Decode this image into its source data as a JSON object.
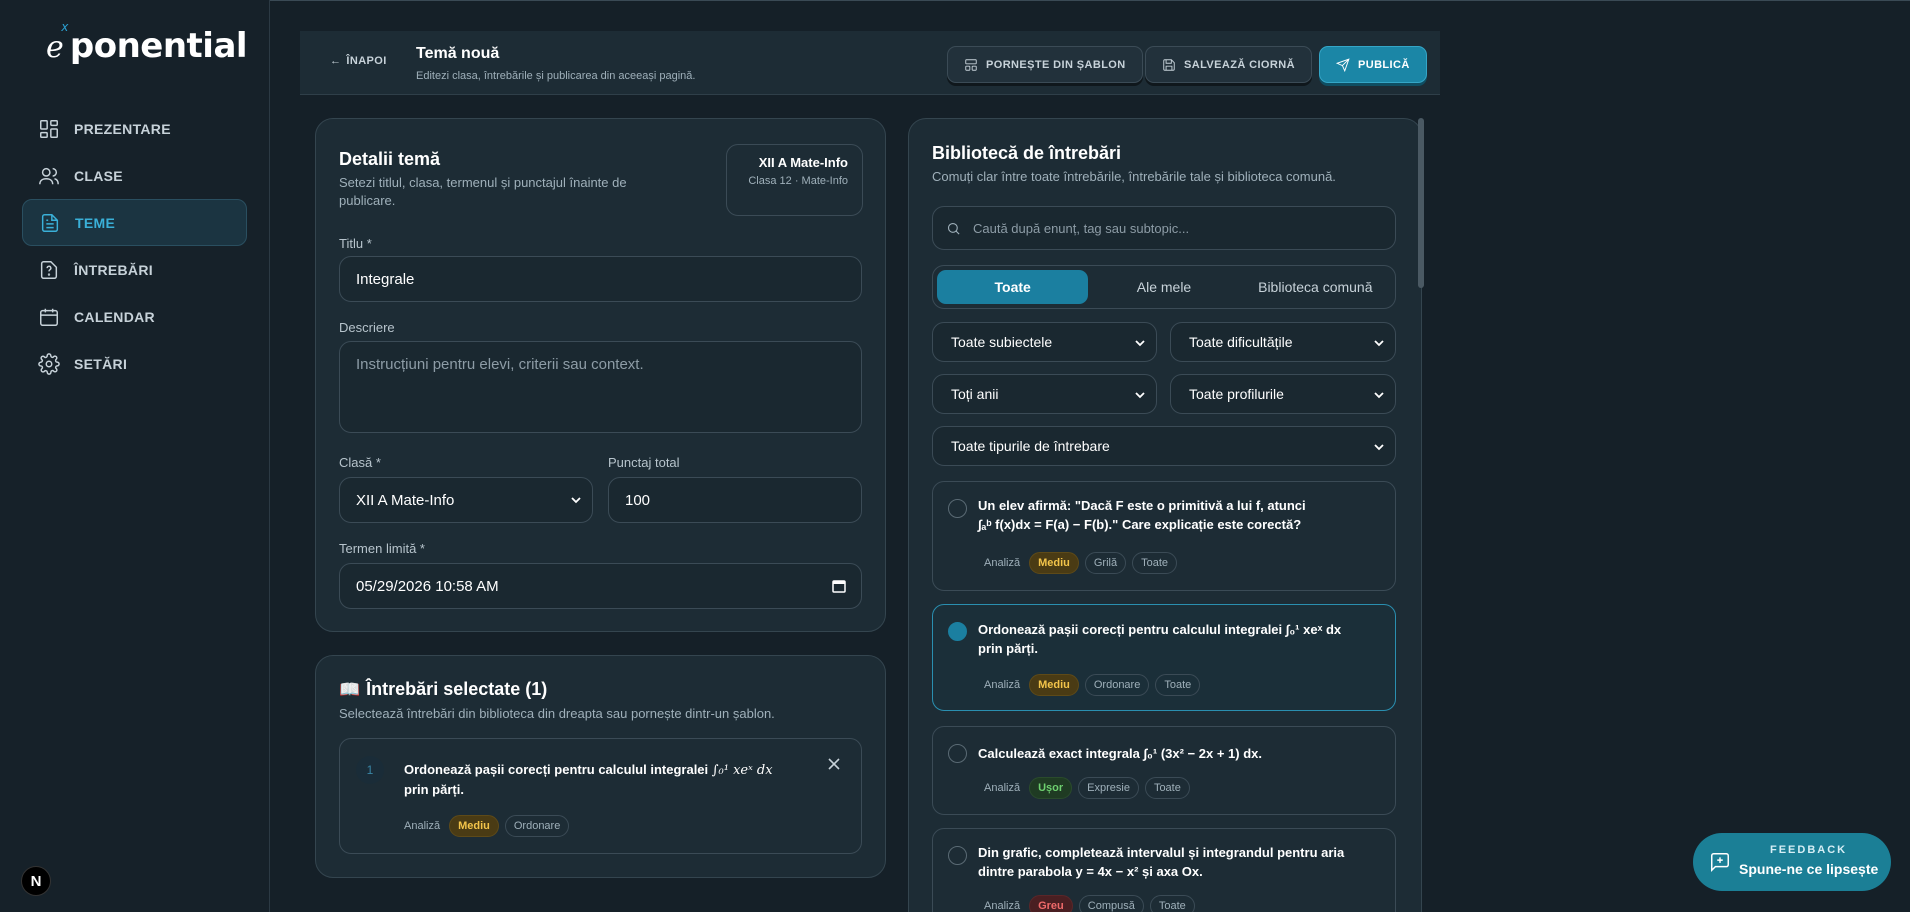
{
  "app": {
    "logo_e": "e",
    "logo_x": "x",
    "logo_rest": "ponential",
    "n_badge": "N"
  },
  "sidebar": {
    "items": [
      {
        "label": "PREZENTARE",
        "icon": "dashboard-icon"
      },
      {
        "label": "CLASE",
        "icon": "users-icon"
      },
      {
        "label": "TEME",
        "icon": "document-icon",
        "active": true
      },
      {
        "label": "ÎNTREBĂRI",
        "icon": "question-icon"
      },
      {
        "label": "CALENDAR",
        "icon": "calendar-icon"
      },
      {
        "label": "SETĂRI",
        "icon": "gear-icon"
      }
    ]
  },
  "header": {
    "back": "ÎNAPOI",
    "title": "Temă nouă",
    "subtitle": "Editezi clasa, întrebările și publicarea din aceeași pagină.",
    "template_btn": "PORNEȘTE DIN ȘABLON",
    "draft_btn": "SALVEAZĂ CIORNĂ",
    "publish_btn": "PUBLICĂ"
  },
  "details": {
    "title": "Detalii temă",
    "subtitle": "Setezi titlul, clasa, termenul și punctajul înainte de publicare.",
    "class_chip": {
      "title": "XII A Mate-Info",
      "sub": "Clasa 12 · Mate-Info"
    },
    "title_label": "Titlu *",
    "title_value": "Integrale",
    "desc_label": "Descriere",
    "desc_placeholder": "Instrucțiuni pentru elevi, criterii sau context.",
    "class_label": "Clasă *",
    "class_value": "XII A Mate-Info",
    "points_label": "Punctaj total",
    "points_value": "100",
    "deadline_label": "Termen limită *",
    "deadline_value": "05/29/2026 10:58 AM"
  },
  "selected": {
    "title": "Întrebări selectate (1)",
    "subtitle": "Selectează întrebări din biblioteca din dreapta sau pornește dintr-un șablon.",
    "items": [
      {
        "num": "1",
        "text_a": "Ordonează pașii corecți pentru calculul integralei ",
        "math": "∫₀¹ xeˣ dx",
        "text_b": "prin părți.",
        "tags": [
          "Analiză",
          "Mediu",
          "Ordonare"
        ]
      }
    ]
  },
  "library": {
    "title": "Bibliotecă de întrebări",
    "subtitle": "Comuți clar între toate întrebările, întrebările tale și biblioteca comună.",
    "search_placeholder": "Caută după enunț, tag sau subtopic...",
    "tabs": [
      "Toate",
      "Ale mele",
      "Biblioteca comună"
    ],
    "filters": {
      "subjects": "Toate subiectele",
      "difficulty": "Toate dificultățile",
      "years": "Toți anii",
      "profiles": "Toate profilurile",
      "types": "Toate tipurile de întrebare"
    },
    "questions": [
      {
        "line1": "Un elev afirmă: \"Dacă F este o primitivă a lui f, atunci",
        "line2": "∫ₐᵇ f(x)dx = F(a) − F(b).\" Care explicație este corectă?",
        "tags": [
          "Analiză",
          "Mediu",
          "Grilă",
          "Toate"
        ]
      },
      {
        "line1": "Ordonează pașii corecți pentru calculul integralei ∫₀¹ xeˣ dx",
        "line2": "prin părți.",
        "tags": [
          "Analiză",
          "Mediu",
          "Ordonare",
          "Toate"
        ]
      },
      {
        "line1": "Calculează exact integrala ∫₀¹ (3x² − 2x + 1) dx.",
        "line2": "",
        "tags": [
          "Analiză",
          "Ușor",
          "Expresie",
          "Toate"
        ]
      },
      {
        "line1": "Din grafic, completează intervalul și integrandul pentru aria",
        "line2": "dintre parabola y = 4x − x² și axa Ox.",
        "tags": [
          "Analiză",
          "Greu",
          "Compusă",
          "Toate"
        ]
      }
    ]
  },
  "feedback": {
    "eyebrow": "FEEDBACK",
    "label": "Spune-ne ce lipsește"
  },
  "colors": {
    "accent": "#1b86a6",
    "background": "#152028",
    "card": "#1d2c35",
    "medium": "#f3c44a",
    "easy": "#6ed06f",
    "hard": "#ef6a6a"
  }
}
